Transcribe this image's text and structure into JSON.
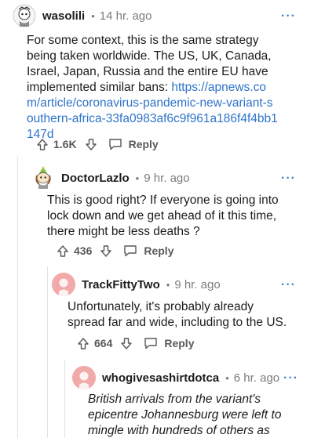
{
  "comments": [
    {
      "username": "wasolili",
      "separator": "•",
      "time": "14 hr. ago",
      "more": "···",
      "text": "For some context, this is the same strategy being taken worldwide. The US, UK, Canada, Israel, Japan, Russia and the entire EU have implemented similar bans:",
      "link": "https://apnews.com/article/coronavirus-pandemic-new-variant-southern-africa-33fa0983af6c9f961a186f4f4bb1147d",
      "score": "1.6K",
      "reply_label": "Reply"
    },
    {
      "username": "DoctorLazlo",
      "separator": "•",
      "time": "9 hr. ago",
      "more": "···",
      "text": "This is good right? If everyone is going into lock down and we get ahead of it this time, there might be less deaths ?",
      "score": "436",
      "reply_label": "Reply"
    },
    {
      "username": "TrackFittyTwo",
      "separator": "•",
      "time": "9 hr. ago",
      "more": "···",
      "text": "Unfortunately, it's probably already spread far and wide, including to the US.",
      "score": "664",
      "reply_label": "Reply"
    },
    {
      "username": "whogivesashirtdotca",
      "separator": "•",
      "time": "6 hr. ago",
      "more": "···",
      "text": "British arrivals from the variant's epicentre Johannesburg were left to mingle with hundreds of others as"
    }
  ],
  "colors": {
    "link": "#2e73c9",
    "meta": "#7c7c7c",
    "more": "#4a7bd0",
    "thread_line": "#e3e3e3"
  }
}
